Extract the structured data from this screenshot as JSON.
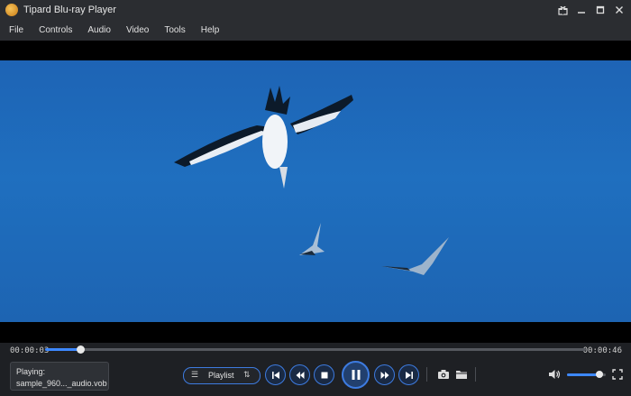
{
  "window": {
    "title": "Tipard Blu-ray Player",
    "logo_icon": "disc-logo-icon"
  },
  "window_controls": [
    {
      "name": "gift-icon"
    },
    {
      "name": "minimize-icon"
    },
    {
      "name": "maximize-icon"
    },
    {
      "name": "close-icon"
    }
  ],
  "menu": {
    "items": [
      {
        "label": "File"
      },
      {
        "label": "Controls"
      },
      {
        "label": "Audio"
      },
      {
        "label": "Video"
      },
      {
        "label": "Tools"
      },
      {
        "label": "Help"
      }
    ]
  },
  "video": {
    "scene": "birds-flying-over-blue-sea"
  },
  "playback": {
    "current_time": "00:00:03",
    "total_time": "00:00:46",
    "progress_fraction": 0.065,
    "now_playing_label": "Playing:",
    "now_playing_file": "sample_960..._audio.vob"
  },
  "playlist": {
    "label": "Playlist"
  },
  "transport": {
    "buttons": [
      "previous-icon",
      "rewind-icon",
      "stop-icon",
      "pause-icon",
      "fast-forward-icon",
      "next-icon"
    ]
  },
  "tools": [
    "snapshot-camera-icon",
    "open-folder-icon"
  ],
  "volume": {
    "level_fraction": 0.83
  },
  "colors": {
    "accent": "#3d88ff",
    "background": "#1e2024",
    "sky": "#1f6fbf"
  }
}
